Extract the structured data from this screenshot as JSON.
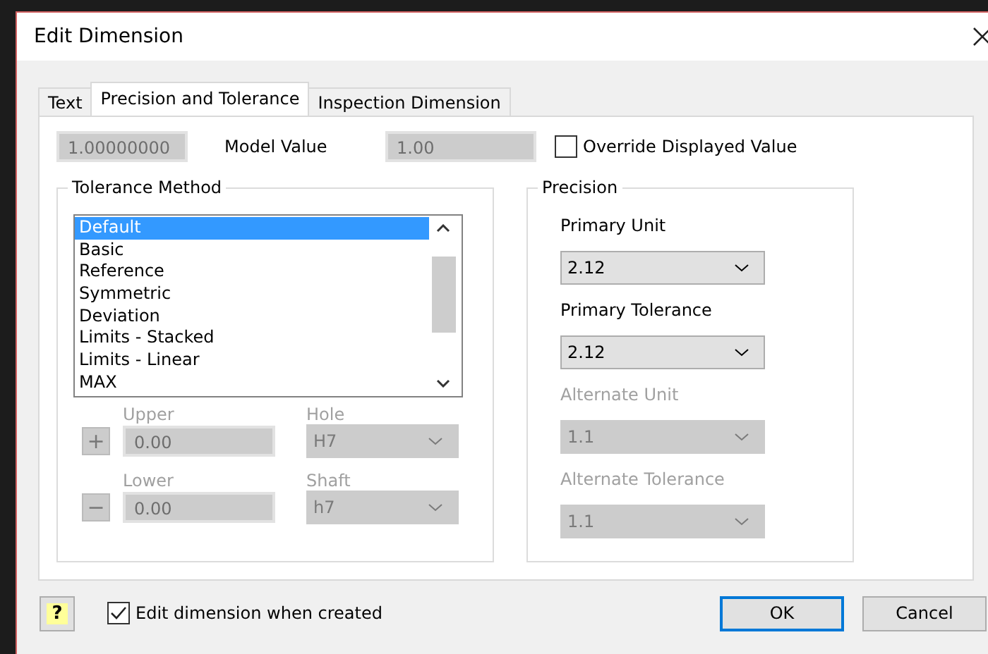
{
  "window": {
    "title": "Edit Dimension"
  },
  "tabs": [
    {
      "label": "Text",
      "selected": false
    },
    {
      "label": "Precision and Tolerance",
      "selected": true
    },
    {
      "label": "Inspection Dimension",
      "selected": false
    }
  ],
  "model_value": {
    "value": "1.00000000",
    "label": "Model Value",
    "displayed_value": "1.00"
  },
  "override": {
    "label": "Override Displayed Value",
    "checked": false
  },
  "tolerance_method": {
    "title": "Tolerance Method",
    "items": [
      {
        "label": "Default",
        "selected": true
      },
      {
        "label": "Basic",
        "selected": false
      },
      {
        "label": "Reference",
        "selected": false
      },
      {
        "label": "Symmetric",
        "selected": false
      },
      {
        "label": "Deviation",
        "selected": false
      },
      {
        "label": "Limits - Stacked",
        "selected": false
      },
      {
        "label": "Limits - Linear",
        "selected": false
      },
      {
        "label": "MAX",
        "selected": false
      }
    ],
    "rows": [
      {
        "sign": "+",
        "label": "Upper",
        "value": "0.00",
        "fit_label": "Hole",
        "fit_value": "H7",
        "disabled": true
      },
      {
        "sign": "−",
        "label": "Lower",
        "value": "0.00",
        "fit_label": "Shaft",
        "fit_value": "h7",
        "disabled": true
      }
    ]
  },
  "precision": {
    "title": "Precision",
    "fields": [
      {
        "label": "Primary Unit",
        "value": "2.12",
        "disabled": false
      },
      {
        "label": "Primary Tolerance",
        "value": "2.12",
        "disabled": false
      },
      {
        "label": "Alternate Unit",
        "value": "1.1",
        "disabled": true
      },
      {
        "label": "Alternate Tolerance",
        "value": "1.1",
        "disabled": true
      }
    ]
  },
  "footer": {
    "help": "?",
    "edit_when_created": {
      "label": "Edit dimension when created",
      "checked": true
    },
    "buttons": [
      {
        "label": "OK",
        "kind": "default"
      },
      {
        "label": "Cancel",
        "kind": "normal"
      }
    ]
  }
}
